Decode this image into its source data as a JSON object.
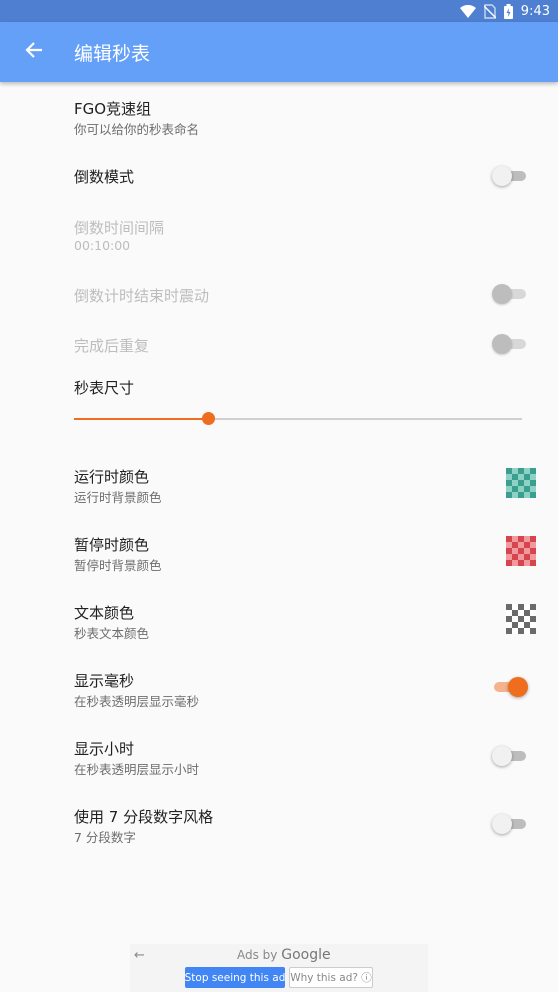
{
  "status_bar": {
    "time": "9:43",
    "icons": [
      "wifi-icon",
      "no-sim-icon",
      "battery-charging-icon"
    ]
  },
  "app_bar": {
    "title": "编辑秒表",
    "back_icon": "arrow-back-icon"
  },
  "settings": {
    "name": {
      "title": "FGO竞速组",
      "subtitle": "你可以给你的秒表命名"
    },
    "countdown_mode": {
      "title": "倒数模式",
      "checked": false
    },
    "countdown_interval": {
      "title": "倒数时间间隔",
      "value": "00:10:00",
      "enabled": false
    },
    "countdown_vibrate": {
      "title": "倒数计时结束时震动",
      "checked": false,
      "enabled": false
    },
    "repeat_after_finish": {
      "title": "完成后重复",
      "checked": false,
      "enabled": false
    },
    "stopwatch_size": {
      "title": "秒表尺寸",
      "value_fraction": 0.3
    },
    "running_color": {
      "title": "运行时颜色",
      "subtitle": "运行时背景颜色",
      "colors": [
        "#3b9f8f",
        "#8ed2c6"
      ]
    },
    "paused_color": {
      "title": "暂停时颜色",
      "subtitle": "暂停时背景颜色",
      "colors": [
        "#d6444e",
        "#f09aa0"
      ]
    },
    "text_color": {
      "title": "文本颜色",
      "subtitle": "秒表文本颜色",
      "colors": [
        "#6a6a6a",
        "#ffffff"
      ]
    },
    "show_millis": {
      "title": "显示毫秒",
      "subtitle": "在秒表透明层显示毫秒",
      "checked": true
    },
    "show_hours": {
      "title": "显示小时",
      "subtitle": "在秒表透明层显示小时",
      "checked": false
    },
    "seven_segment": {
      "title": "使用 7 分段数字风格",
      "subtitle": "7 分段数字",
      "checked": false
    }
  },
  "ad": {
    "label": "Ads by",
    "brand": "Google",
    "stop_button": "Stop seeing this ad",
    "why_button": "Why this ad? ⓘ"
  },
  "colors": {
    "accent": "#ee6d1f",
    "app_bar": "#64a0f8",
    "status_bar": "#4f7fd0"
  }
}
